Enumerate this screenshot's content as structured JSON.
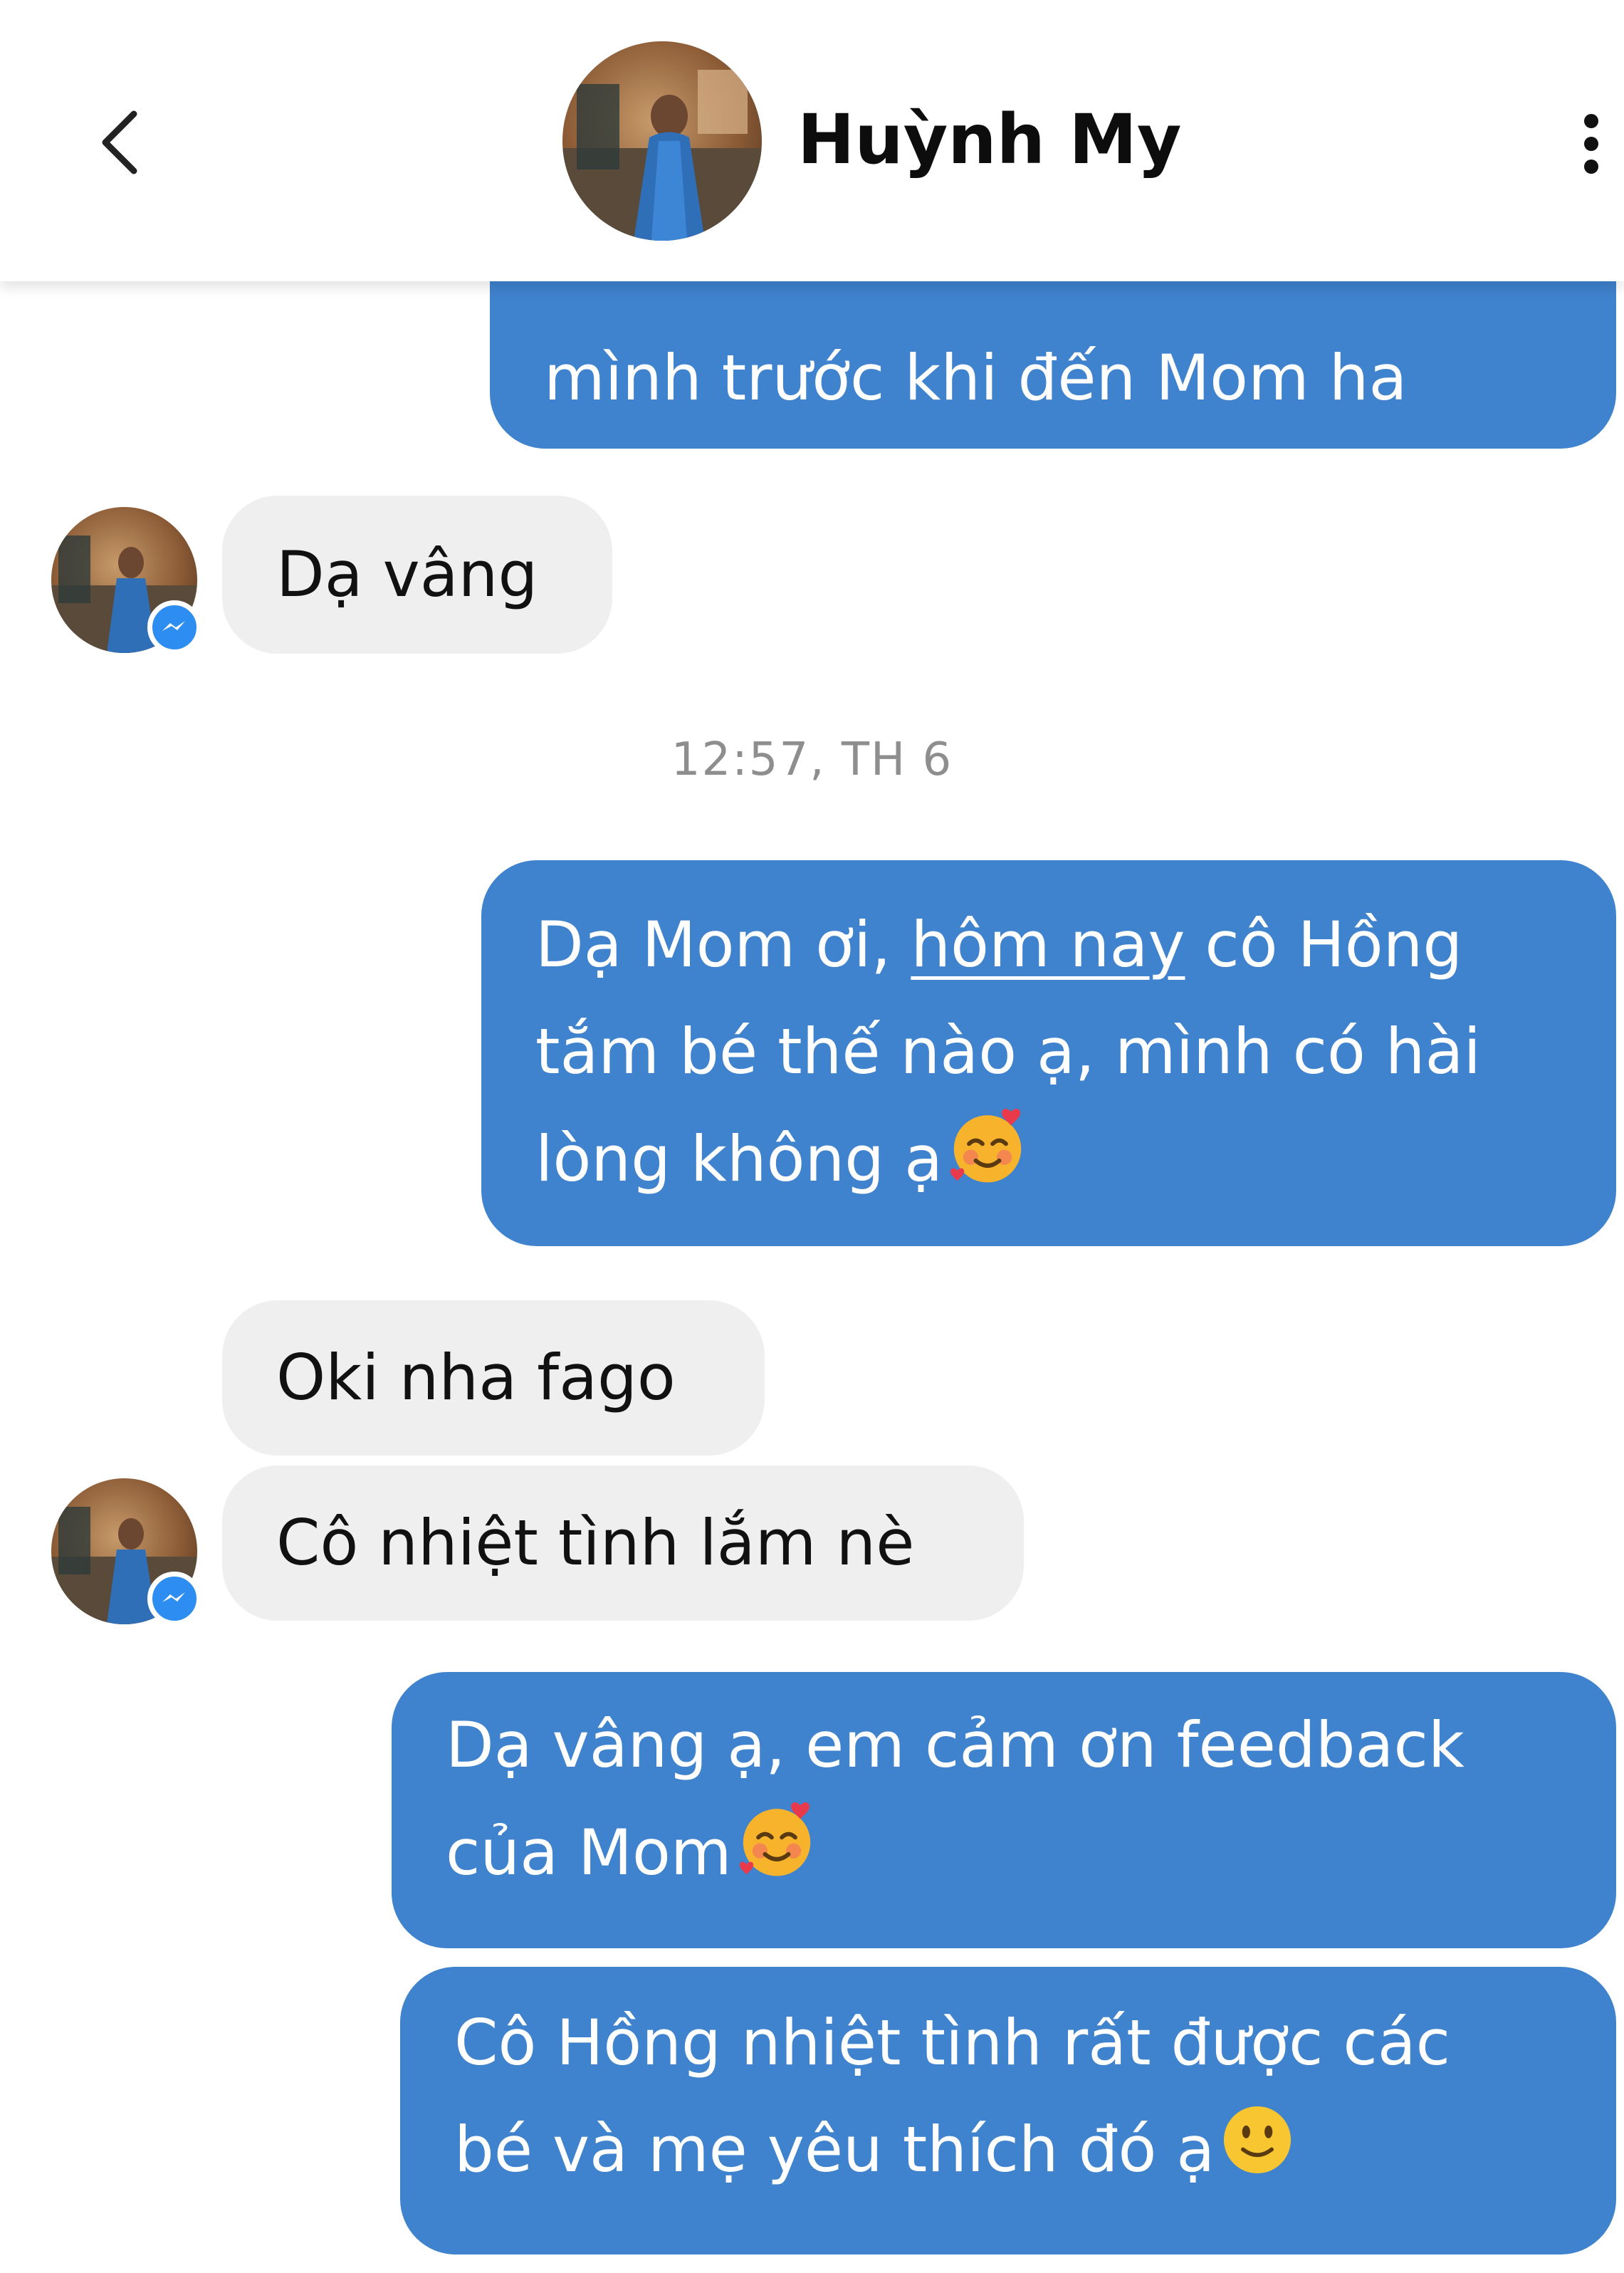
{
  "header": {
    "contact_name": "Huỳnh My",
    "back_icon": "chevron-left-icon",
    "more_icon": "vertical-dots-icon"
  },
  "colors": {
    "outgoing_bubble": "#3f82cd",
    "incoming_bubble": "#efefef",
    "badge": "#2d8df0"
  },
  "messages": [
    {
      "direction": "out",
      "lines": [
        "mình trước khi đến Mom ha"
      ]
    },
    {
      "direction": "in",
      "lines": [
        "Dạ vâng"
      ]
    },
    {
      "timestamp": "12:57, TH 6"
    },
    {
      "direction": "out",
      "lines": [
        "Dạ Mom ơi, ",
        "hôm nay",
        " cô Hồng",
        "tắm bé thế nào ạ, mình có hài",
        "lòng không ạ"
      ],
      "emoji": "smiling-face-with-hearts"
    },
    {
      "direction": "in",
      "lines": [
        "Oki nha fago"
      ]
    },
    {
      "direction": "in",
      "lines": [
        "Cô nhiệt tình lắm nè"
      ]
    },
    {
      "direction": "out",
      "lines": [
        "Dạ vâng ạ, em cảm ơn feedback",
        "của Mom"
      ],
      "emoji": "smiling-face-with-hearts"
    },
    {
      "direction": "out",
      "lines": [
        "Cô Hồng nhiệt tình rất được các",
        "bé và mẹ yêu thích đó ạ"
      ],
      "emoji": "slightly-smiling-face"
    }
  ]
}
